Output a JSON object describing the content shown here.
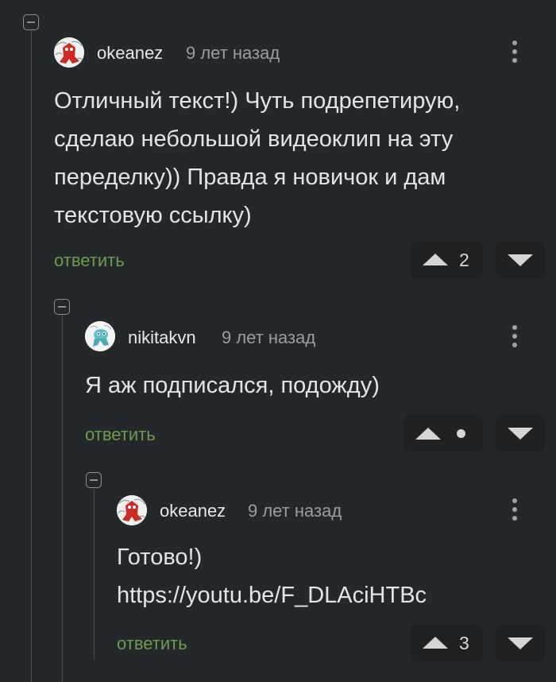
{
  "comments": [
    {
      "username": "okeanez",
      "time": "9 лет назад",
      "text": "Отличный текст!) Чуть подрепетирую,\nсделаю небольшой видеоклип на эту\nпеределку)) Правда я новичок и дам\nтекстовую ссылку)",
      "reply_label": "ответить",
      "score": "2",
      "avatar_icon": "red-character-avatar"
    },
    {
      "username": "nikitakvn",
      "time": "9 лет назад",
      "text": "Я аж подписался, подожду)",
      "reply_label": "ответить",
      "score": "",
      "avatar_icon": "cyan-character-avatar"
    },
    {
      "username": "okeanez",
      "time": "9 лет назад",
      "text": "Готово!)\nhttps://youtu.be/F_DLAciHTBc",
      "reply_label": "ответить",
      "score": "3",
      "avatar_icon": "red-character-avatar"
    }
  ],
  "colors": {
    "background": "#25282b",
    "reply_link": "#6b9d4a",
    "vote_button": "#1f2123",
    "thread_line": "#4a4d50"
  }
}
